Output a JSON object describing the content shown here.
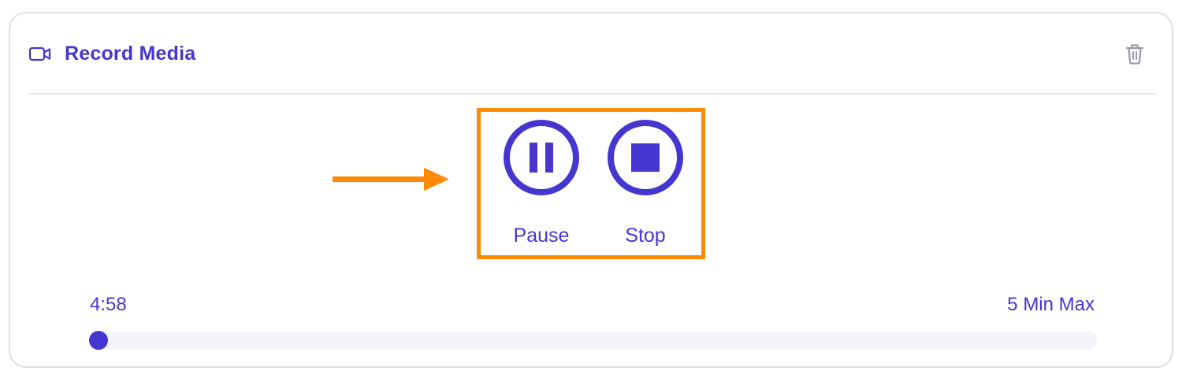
{
  "card": {
    "title": "Record Media",
    "title_icon": "video-camera-icon",
    "delete_icon": "trash-icon"
  },
  "controls": {
    "pause_label": "Pause",
    "pause_icon": "pause-icon",
    "stop_label": "Stop",
    "stop_icon": "stop-icon"
  },
  "annotation": {
    "arrow_icon": "arrow-right-icon",
    "highlight_color": "#ff8a05"
  },
  "progress": {
    "elapsed": "4:58",
    "max_label": "5 Min Max",
    "fraction": 0.0
  },
  "colors": {
    "accent": "#4636d0",
    "annotation": "#ff8a05",
    "border": "#dedee3",
    "track": "#f4f4fb"
  }
}
